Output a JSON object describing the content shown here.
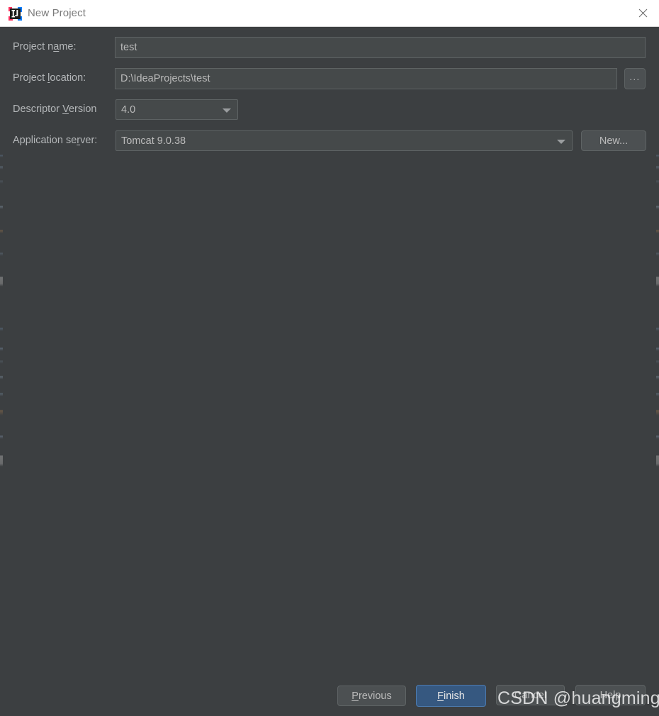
{
  "window": {
    "title": "New Project",
    "icon": "intellij-idea-icon",
    "close_label": "×",
    "titlebar_bg": "#ffffff",
    "body_bg": "#3c3f41",
    "accent": "#365880"
  },
  "form": {
    "rows": [
      {
        "label_pre": "Project n",
        "label_mnemonic": "a",
        "label_post": "me:",
        "field_type": "text",
        "value": "test",
        "placeholder": ""
      },
      {
        "label_pre": "Project ",
        "label_mnemonic": "l",
        "label_post": "ocation:",
        "field_type": "text",
        "value": "D:\\IdeaProjects\\test",
        "placeholder": ""
      },
      {
        "label_pre": "Descriptor ",
        "label_mnemonic": "V",
        "label_post": "ersion",
        "field_type": "combo",
        "value": "4.0",
        "placeholder": ""
      },
      {
        "label_pre": "Application se",
        "label_mnemonic": "r",
        "label_post": "ver:",
        "field_type": "combo",
        "value": "Tomcat 9.0.38",
        "placeholder": ""
      }
    ],
    "browse_label": "...",
    "new_server_label": "New..."
  },
  "buttons": {
    "previous": {
      "pre": "",
      "mnemonic": "P",
      "post": "revious"
    },
    "finish": {
      "pre": "",
      "mnemonic": "F",
      "post": "inish"
    },
    "cancel": {
      "pre": "Cancel",
      "mnemonic": "",
      "post": ""
    },
    "help": {
      "pre": "Help",
      "mnemonic": "",
      "post": ""
    }
  },
  "watermark": {
    "text": "CSDN @huangmingcsdn"
  }
}
